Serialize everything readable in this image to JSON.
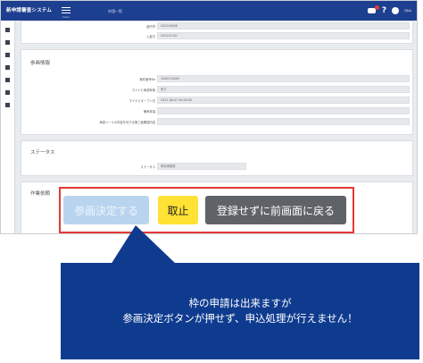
{
  "app": {
    "brand": "新申請審査システム",
    "menu_label": "menu",
    "breadcrumb": "申請一覧",
    "user": "Q&A"
  },
  "sections": {
    "top_rows": [
      {
        "label": "過不符",
        "value": "2022/06/08"
      },
      {
        "label": "入金日",
        "value": "2022/07/01"
      }
    ],
    "reference": {
      "title": "参画情報",
      "rows": [
        {
          "label": "案件番号No",
          "value": "1000234005"
        },
        {
          "label": "マイナビ承認有無",
          "value": "有り"
        },
        {
          "label": "マイナビオープン日",
          "value": "2022-06-07 00:00:00"
        },
        {
          "label": "備考事項",
          "value": ""
        },
        {
          "label": "承認メールの内容を対する第三者確認内容",
          "value": ""
        }
      ]
    },
    "status": {
      "title": "ステータス",
      "rows": [
        {
          "label": "ステータス",
          "value": "申請承認済"
        }
      ]
    },
    "work": {
      "title": "作業依頼"
    }
  },
  "buttons": {
    "decide": "参画決定する",
    "cancel": "取止",
    "back": "登録せずに前画面に戻る"
  },
  "callout": {
    "line1": "枠の申請は出来ますが",
    "line2": "参画決定ボタンが押せず、申込処理が行えません！"
  },
  "colors": {
    "topbar": "#1d3f8f",
    "highlight_border": "#e53935",
    "decide_disabled": "#b9d4ee",
    "cancel": "#ffe234",
    "back": "#5f6368",
    "callout_bg": "#0f3b8f"
  }
}
